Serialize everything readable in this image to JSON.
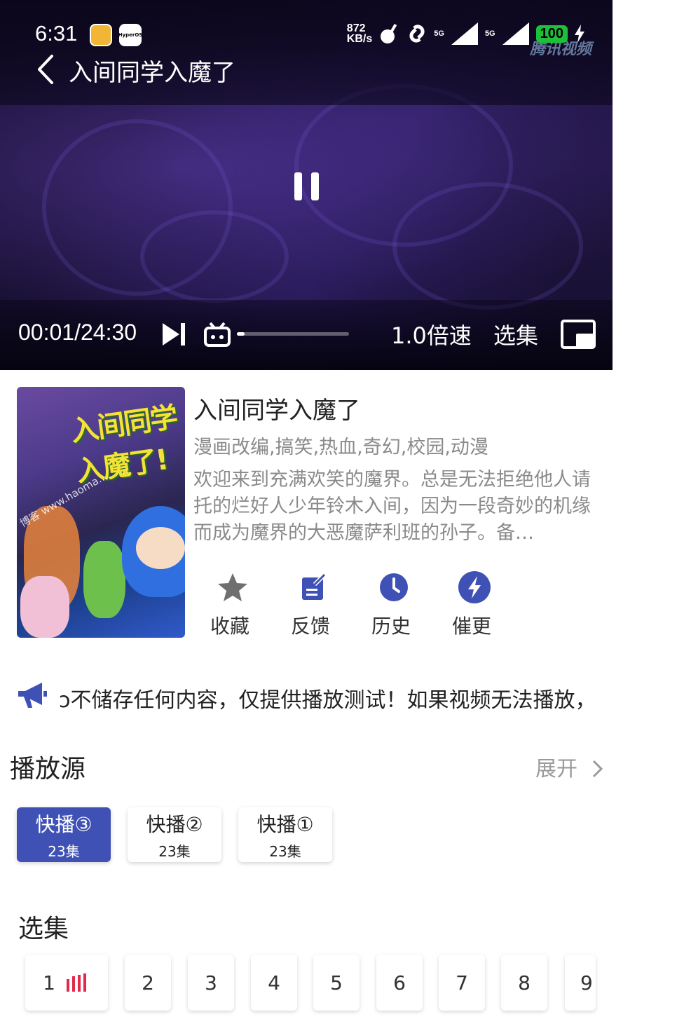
{
  "status_bar": {
    "time": "6:31",
    "app_badge": "HyperOS",
    "speed_value": "872",
    "speed_unit": "KB/s",
    "signal1": "5G",
    "signal2": "5G",
    "battery": "100",
    "watermark": "腾讯视频"
  },
  "player": {
    "title": "入间同学入魔了",
    "timecode": "00:01/24:30",
    "progress": 0.07,
    "speed_label": "1.0倍速",
    "episodes_label": "选集"
  },
  "show": {
    "title": "入间同学入魔了",
    "genres": "漫画改编,搞笑,热血,奇幻,校园,动漫",
    "description": "欢迎来到充满欢笑的魔界。总是无法拒绝他人请托的烂好人少年铃木入间，因为一段奇妙的机缘而成为魔界的大恶魔萨利班的孙子。备…",
    "poster_title": "入间同学入魔了!",
    "poster_watermark": "博客 www.haoma..."
  },
  "actions": [
    {
      "label": "收藏",
      "icon": "star-icon"
    },
    {
      "label": "反馈",
      "icon": "edit-icon"
    },
    {
      "label": "历史",
      "icon": "clock-icon"
    },
    {
      "label": "催更",
      "icon": "lightning-icon"
    }
  ],
  "notice": "ɔ不储存任何内容，仅提供播放测试！如果视频无法播放，",
  "sources_section": {
    "title": "播放源",
    "expand_label": "展开",
    "items": [
      {
        "name": "快播③",
        "count": "23集",
        "active": true
      },
      {
        "name": "快播②",
        "count": "23集",
        "active": false
      },
      {
        "name": "快播①",
        "count": "23集",
        "active": false
      }
    ]
  },
  "episodes_section": {
    "title": "选集",
    "items": [
      "1",
      "2",
      "3",
      "4",
      "5",
      "6",
      "7",
      "8",
      "9"
    ]
  },
  "colors": {
    "accent": "#3f51b5",
    "action_gray": "#6f6f6f",
    "playing_indicator": "#e0294b"
  }
}
